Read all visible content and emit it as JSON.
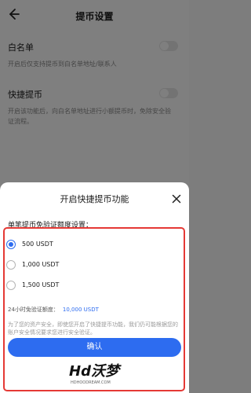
{
  "header": {
    "title": "提币设置"
  },
  "settings": [
    {
      "title": "白名单",
      "desc": "开启后仅支持提币到白名单地址/联系人"
    },
    {
      "title": "快捷提币",
      "desc": "开启该功能后，向白名单地址进行小额提币时，免除安全验证流程。"
    }
  ],
  "sheet": {
    "title": "开启快捷提币功能",
    "section_label": "单笔提币免验证额度设置：",
    "options": [
      {
        "label": "500 USDT",
        "checked": true
      },
      {
        "label": "1,000 USDT",
        "checked": false
      },
      {
        "label": "1,500 USDT",
        "checked": false
      }
    ],
    "limit_label": "24小时免验证额度：",
    "limit_value": "10,000 USDT",
    "note": "为了您的资产安全，即使您开启了快捷提币功能，我们仍可能根据您的账户安全情况要求您进行安全验证。",
    "confirm_label": "确认"
  },
  "watermark": {
    "logo": "Hd沃梦",
    "sub": "HDHOODREAM.COM"
  },
  "colors": {
    "accent": "#2d6cf0",
    "highlight": "#e53935"
  },
  "icons": {
    "back": "arrow-left-icon",
    "close": "close-icon"
  }
}
